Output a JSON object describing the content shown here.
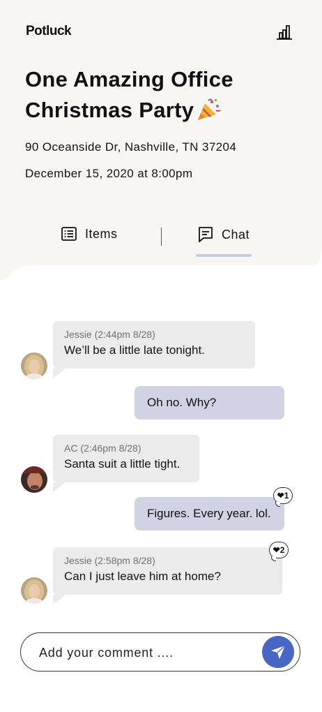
{
  "app": {
    "logo_text": "Potluck"
  },
  "event": {
    "title": "One Amazing Office Christmas Party",
    "address": "90 Oceanside Dr, Nashville, TN 37204",
    "datetime": "December 15, 2020 at 8:00pm"
  },
  "tabs": [
    {
      "label": "Items",
      "icon": "list-icon",
      "active": false
    },
    {
      "label": "Chat",
      "icon": "chat-icon",
      "active": true
    }
  ],
  "messages": [
    {
      "direction": "in",
      "sender": "Jessie (2:44pm 8/28)",
      "text": "We’ll be a little late tonight.",
      "avatar": "avatar-jessie"
    },
    {
      "direction": "out",
      "text": "Oh no. Why?"
    },
    {
      "direction": "in",
      "sender": "AC (2:46pm 8/28)",
      "text": "Santa suit a little tight.",
      "avatar": "avatar-ac"
    },
    {
      "direction": "out",
      "text": "Figures. Every year. lol.",
      "reaction": {
        "icon": "heart-icon",
        "count": "1"
      }
    },
    {
      "direction": "in",
      "sender": "Jessie (2:58pm 8/28)",
      "text": "Can I just leave him at home?",
      "avatar": "avatar-jessie",
      "reaction": {
        "icon": "heart-icon",
        "count": "2"
      }
    }
  ],
  "composer": {
    "placeholder": "Add your comment ....",
    "send_icon": "send-icon"
  },
  "colors": {
    "header_bg": "#f7f6f2",
    "incoming_bubble": "#ebebeb",
    "outgoing_bubble": "#cfd3e3",
    "accent": "#4766c6"
  }
}
